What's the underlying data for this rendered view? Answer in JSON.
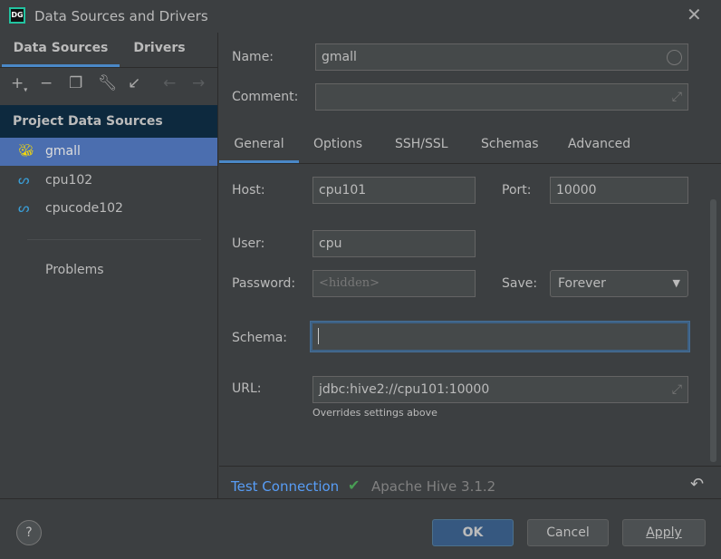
{
  "window": {
    "title": "Data Sources and Drivers",
    "logo": "DG",
    "close_icon": "close-icon"
  },
  "left": {
    "tabs": [
      "Data Sources",
      "Drivers"
    ],
    "toolbar": [
      "add-icon",
      "remove-icon",
      "copy-icon",
      "wrench-icon",
      "import-icon",
      "back-icon",
      "forward-icon"
    ],
    "section": "Project Data Sources",
    "items": [
      {
        "label": "gmall",
        "icon": "hive-icon"
      },
      {
        "label": "cpu102",
        "icon": "mysql-icon"
      },
      {
        "label": "cpucode102",
        "icon": "mysql-icon"
      }
    ],
    "problems": "Problems"
  },
  "form": {
    "name_label": "Name:",
    "name_value": "gmall",
    "comment_label": "Comment:",
    "comment_value": "",
    "tabs": [
      "General",
      "Options",
      "SSH/SSL",
      "Schemas",
      "Advanced"
    ],
    "host_label": "Host:",
    "host": "cpu101",
    "port_label": "Port:",
    "port": "10000",
    "user_label": "User:",
    "user": "cpu",
    "password_label": "Password:",
    "password_placeholder": "<hidden>",
    "save_label": "Save:",
    "save_value": "Forever",
    "schema_label": "Schema:",
    "schema": "",
    "url_label": "URL:",
    "url": "jdbc:hive2://cpu101:10000",
    "url_hint": "Overrides settings above"
  },
  "status": {
    "test_connection": "Test Connection",
    "result": "Apache Hive 3.1.2",
    "accent": "#589df6",
    "ok_color": "#499c54"
  },
  "buttons": {
    "help": "?",
    "ok": "OK",
    "cancel": "Cancel",
    "apply": "Apply"
  }
}
